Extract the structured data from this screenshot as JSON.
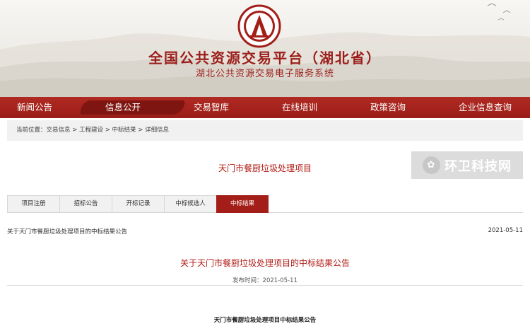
{
  "banner": {
    "title": "全国公共资源交易平台（湖北省）",
    "subtitle": "湖北公共资源交易电子服务系统",
    "emblem_icon": "emblem-logo",
    "accent": "#9b1e1a"
  },
  "nav": {
    "items": [
      {
        "label": "新闻公告"
      },
      {
        "label": "信息公开"
      },
      {
        "label": "交易智库"
      },
      {
        "label": "在线培训"
      },
      {
        "label": "政策咨询"
      },
      {
        "label": "企业信息查询"
      }
    ],
    "active": "信息公开",
    "color": "#a4211a"
  },
  "breadcrumb": {
    "text": "当前位置：交易信息 > 工程建设 > 中标结果 > 详细信息"
  },
  "project": {
    "title": "天门市餐厨垃圾处理项目"
  },
  "watermark": {
    "text": "环卫科技网",
    "icon": "leaf-icon"
  },
  "tabs": {
    "items": [
      {
        "label": "项目注册"
      },
      {
        "label": "招标公告"
      },
      {
        "label": "开标记录"
      },
      {
        "label": "中标候选人"
      },
      {
        "label": "中标结果"
      }
    ],
    "active": "中标结果"
  },
  "notice": {
    "title": "关于天门市餐厨垃圾处理项目的中标结果公告",
    "date": "2021-05-11"
  },
  "announcement": {
    "title": "关于天门市餐厨垃圾处理项目的中标结果公告",
    "publish_time": "发布时间：2021-05-11",
    "doc_title": "天门市餐厨垃圾处理项目中标结果公告"
  }
}
